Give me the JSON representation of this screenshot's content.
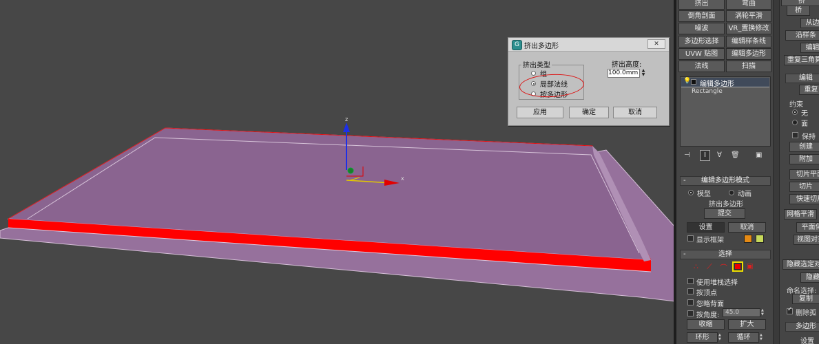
{
  "viewport": {
    "axis_labels": {
      "z": "z",
      "x": "x"
    }
  },
  "dialog": {
    "title": "挤出多边形",
    "close": "✕",
    "group_label": "挤出类型",
    "options": [
      "组",
      "局部法线",
      "按多边形"
    ],
    "selected": 1,
    "height_label": "挤出高度:",
    "height_value": "100.0mm",
    "buttons": {
      "apply": "应用",
      "ok": "确定",
      "cancel": "取消"
    }
  },
  "modifier_buttons": [
    [
      "挤出",
      "弯曲"
    ],
    [
      "倒角剖面",
      "涡轮平滑"
    ],
    [
      "噪波",
      "VR_置换修改"
    ],
    [
      "多边形选择",
      "编辑样条线"
    ],
    [
      "UVW 贴图",
      "编辑多边形"
    ],
    [
      "法线",
      "扫描"
    ]
  ],
  "stack": {
    "items": [
      "编辑多边形",
      "Rectangle"
    ]
  },
  "stack_tools": [
    "pin-icon",
    "show-end-result-icon",
    "make-unique-icon",
    "remove-modifier-icon",
    "configure-icon"
  ],
  "edit_poly_mode": {
    "header": "编辑多边形模式",
    "model": "模型",
    "animate": "动画",
    "current_op": "挤出多边形",
    "commit": "提交",
    "settings": "设置",
    "cancel": "取消",
    "show_cage": "显示框架",
    "cage_colors": [
      "#e58a14",
      "#c7d95a"
    ]
  },
  "selection": {
    "header": "选择",
    "by_vertex_stack": "使用堆栈选择",
    "by_vertex": "按顶点",
    "ignore_backfacing": "忽略背面",
    "by_angle": "按角度:",
    "angle_value": "45.0",
    "shrink": "收缩",
    "grow": "扩大",
    "ring": "环形",
    "loop": "循环"
  },
  "right_panel": {
    "items": [
      "挤",
      "桥",
      "从边",
      "沿样条",
      "编辑",
      "重复三角算",
      "编辑",
      "重复",
      "约束",
      "无",
      "面",
      "保持",
      "创建",
      "附加",
      "切片平面",
      "切片",
      "快速切片",
      "网格平滑",
      "平面化",
      "视图对齐",
      "隐藏选定对",
      "隐藏",
      "命名选择:",
      "复制",
      "删除孤",
      "多边形",
      "设置"
    ]
  }
}
